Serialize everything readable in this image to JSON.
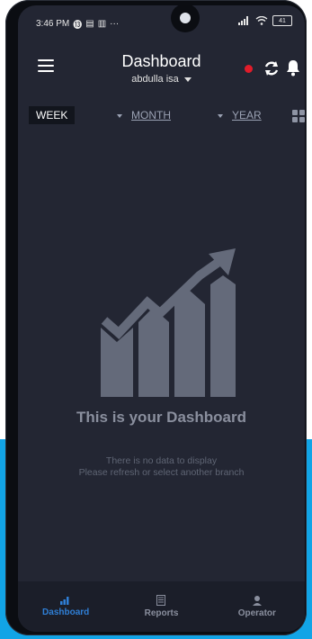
{
  "status_bar": {
    "time": "3:46 PM",
    "battery": "41"
  },
  "app_bar": {
    "title": "Dashboard",
    "user": "abdulla isa"
  },
  "period_tabs": {
    "week": "WEEK",
    "month": "MONTH",
    "year": "YEAR"
  },
  "empty_state": {
    "title": "This is your Dashboard",
    "line1": "There is no data to display",
    "line2": "Please refresh or select another branch"
  },
  "bottom_nav": {
    "items": [
      {
        "label": "Dashboard",
        "icon": "bar-chart-icon",
        "active": true
      },
      {
        "label": "Reports",
        "icon": "report-icon",
        "active": false
      },
      {
        "label": "Operator",
        "icon": "operator-icon",
        "active": false
      }
    ]
  },
  "colors": {
    "background": "#232633",
    "accent": "#2f7fd6",
    "record": "#e11c2a",
    "promo_background": "#12a4e6"
  }
}
